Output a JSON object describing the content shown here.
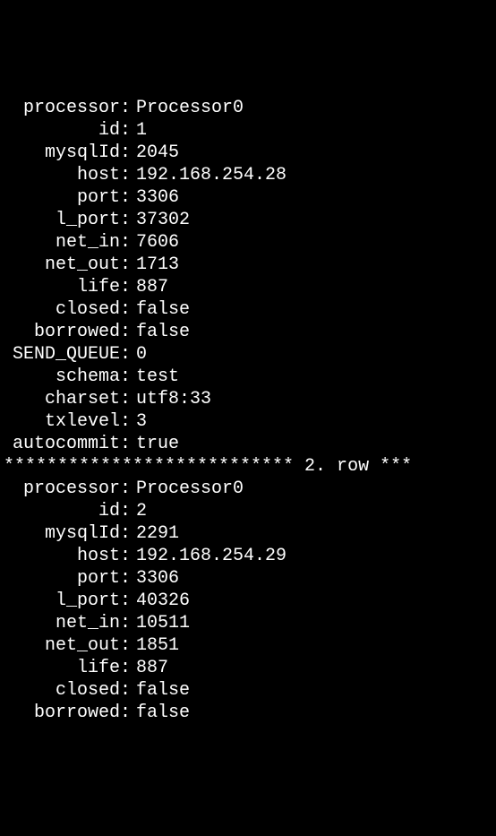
{
  "rows": [
    {
      "fields": [
        {
          "label": "processor",
          "value": "Processor0"
        },
        {
          "label": "id",
          "value": "1"
        },
        {
          "label": "mysqlId",
          "value": "2045"
        },
        {
          "label": "host",
          "value": "192.168.254.28"
        },
        {
          "label": "port",
          "value": "3306"
        },
        {
          "label": "l_port",
          "value": "37302"
        },
        {
          "label": "net_in",
          "value": "7606"
        },
        {
          "label": "net_out",
          "value": "1713"
        },
        {
          "label": "life",
          "value": "887"
        },
        {
          "label": "closed",
          "value": "false"
        },
        {
          "label": "borrowed",
          "value": "false"
        },
        {
          "label": "SEND_QUEUE",
          "value": "0"
        },
        {
          "label": "schema",
          "value": "test"
        },
        {
          "label": "charset",
          "value": "utf8:33"
        },
        {
          "label": "txlevel",
          "value": "3"
        },
        {
          "label": "autocommit",
          "value": "true"
        }
      ]
    },
    {
      "separator": "*************************** 2. row ***",
      "fields": [
        {
          "label": "processor",
          "value": "Processor0"
        },
        {
          "label": "id",
          "value": "2"
        },
        {
          "label": "mysqlId",
          "value": "2291"
        },
        {
          "label": "host",
          "value": "192.168.254.29"
        },
        {
          "label": "port",
          "value": "3306"
        },
        {
          "label": "l_port",
          "value": "40326"
        },
        {
          "label": "net_in",
          "value": "10511"
        },
        {
          "label": "net_out",
          "value": "1851"
        },
        {
          "label": "life",
          "value": "887"
        },
        {
          "label": "closed",
          "value": "false"
        },
        {
          "label": "borrowed",
          "value": "false"
        }
      ]
    }
  ]
}
